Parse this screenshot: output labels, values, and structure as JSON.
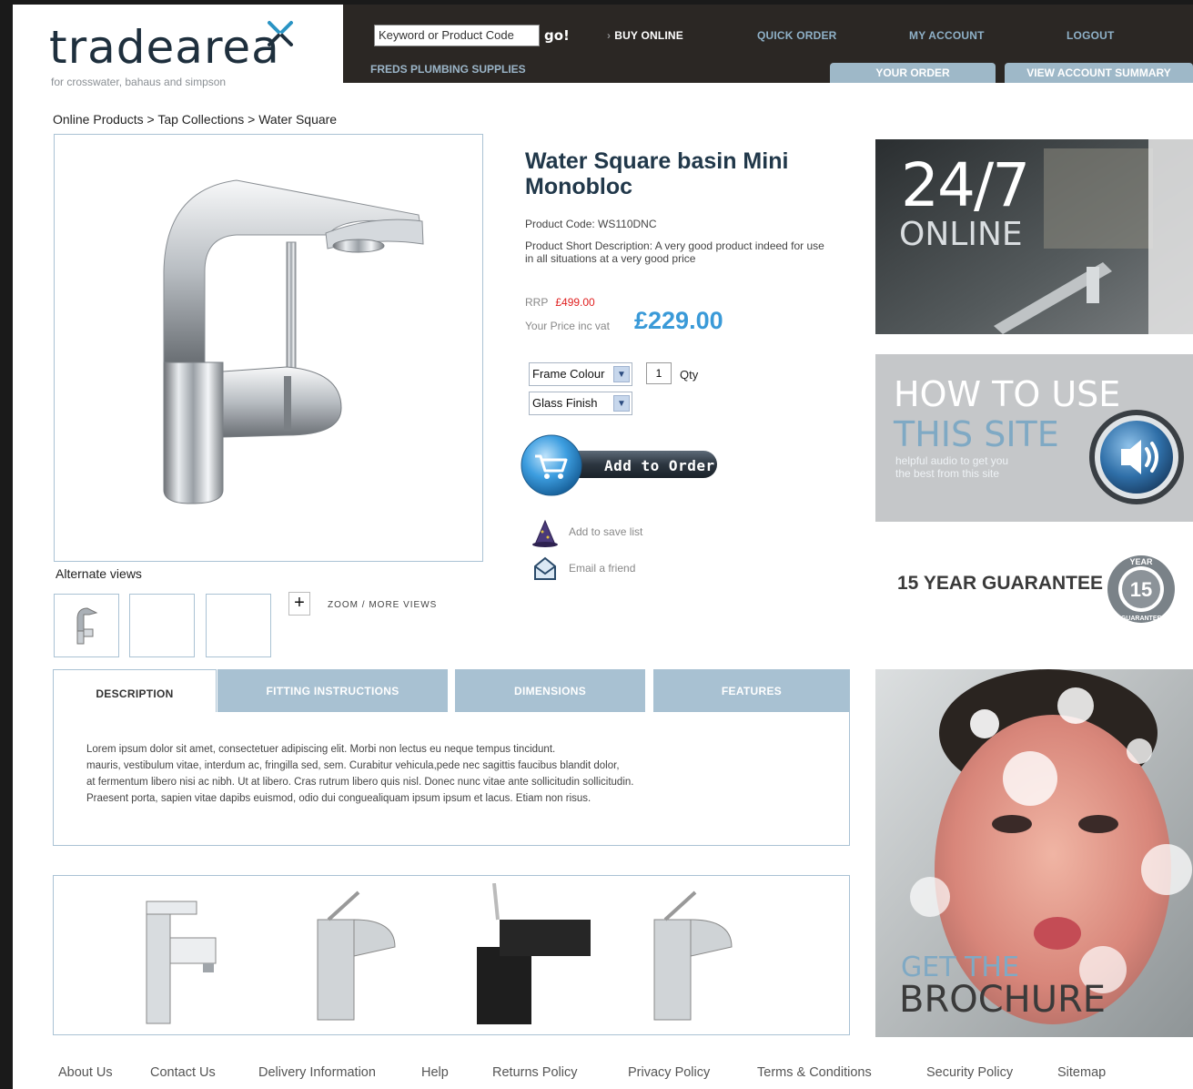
{
  "logo": {
    "word": "tradearea",
    "tagline": "for crosswater, bahaus and simpson"
  },
  "header": {
    "search": {
      "value": "Keyword or Product Code",
      "go_label": "go!"
    },
    "nav": [
      {
        "label": "BUY ONLINE"
      },
      {
        "label": "QUICK ORDER"
      },
      {
        "label": "MY ACCOUNT"
      },
      {
        "label": "LOGOUT"
      }
    ],
    "company": "FREDS PLUMBING SUPPLIES",
    "tabs": [
      {
        "label": "YOUR ORDER"
      },
      {
        "label": "VIEW ACCOUNT SUMMARY"
      }
    ]
  },
  "breadcrumb": [
    "Online Products",
    "Tap Collections",
    "Water Square"
  ],
  "breadcrumb_sep": ">",
  "product": {
    "title": "Water Square basin Mini Monobloc",
    "code_line": "Product Code: WS110DNC",
    "short_desc": "Product Short Description:  A very good product indeed for use in all situations at a very good price",
    "rrp_label": "RRP",
    "rrp_value": "£499.00",
    "price_label": "Your Price inc vat",
    "price": "£229.00",
    "options": [
      {
        "selected": "Frame Colour"
      },
      {
        "selected": "Glass Finish"
      }
    ],
    "qty_value": "1",
    "qty_label": "Qty",
    "add_to_order": "Add to Order",
    "save_list": "Add to save list",
    "email_friend": "Email a friend",
    "alternate_views_label": "Alternate views",
    "zoom_label": "ZOOM / MORE VIEWS"
  },
  "tabs": {
    "items": [
      {
        "label": "DESCRIPTION"
      },
      {
        "label": "FITTING INSTRUCTIONS"
      },
      {
        "label": "DIMENSIONS"
      },
      {
        "label": "FEATURES"
      }
    ],
    "active": "DESCRIPTION",
    "body_lines": [
      "Lorem ipsum dolor sit amet, consectetuer adipiscing elit. Morbi non lectus eu neque tempus tincidunt.",
      "mauris, vestibulum vitae, interdum ac, fringilla sed, sem. Curabitur vehicula,pede nec sagittis faucibus blandit dolor,",
      "at fermentum libero nisi ac nibh. Ut at libero. Cras rutrum libero quis nisl. Donec nunc vitae ante sollicitudin sollicitudin.",
      "Praesent porta, sapien vitae dapibs euismod, odio dui conguealiquam ipsum ipsum et lacus. Etiam non risus."
    ]
  },
  "banners": {
    "online": {
      "big": "24/7",
      "small": "ONLINE"
    },
    "how_to": {
      "line1": "HOW TO USE",
      "line2": "THIS SITE",
      "sub1": "helpful audio to get you",
      "sub2": "the best from this site"
    },
    "guarantee": {
      "text": "15 YEAR GUARANTEE",
      "badge_top": "YEAR",
      "badge_num": "15",
      "badge_bottom": "GUARANTEE"
    },
    "brochure": {
      "line1": "GET THE",
      "line2": "BROCHURE"
    }
  },
  "footer": [
    "About Us",
    "Contact Us",
    "Delivery Information",
    "Help",
    "Returns Policy",
    "Privacy Policy",
    "Terms & Conditions",
    "Security Policy",
    "Sitemap"
  ],
  "colors": {
    "header_bg": "#2b2724",
    "accent_blue": "#3a9ad8",
    "tab_blue": "#a8c1d2",
    "rrp_red": "#e02020",
    "title_navy": "#21384a"
  }
}
